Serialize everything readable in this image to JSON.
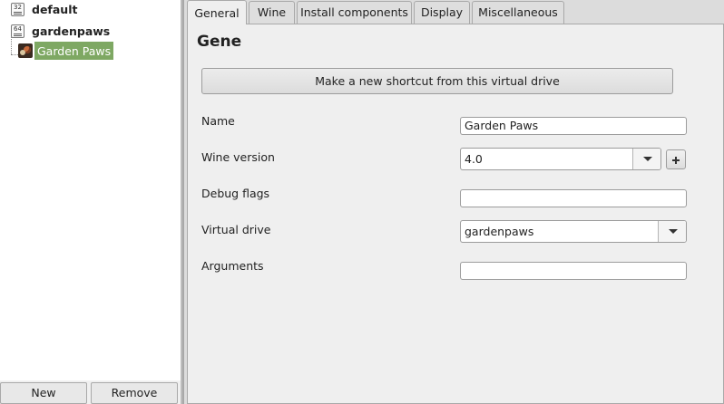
{
  "tree": {
    "prefixes": [
      {
        "arch": "32",
        "name": "default"
      },
      {
        "arch": "64",
        "name": "gardenpaws"
      }
    ],
    "shortcut": {
      "label": "Garden Paws",
      "icon": "garden-paws-app-icon"
    }
  },
  "left_buttons": {
    "new_label": "New",
    "remove_label": "Remove"
  },
  "tabs": [
    {
      "label": "General"
    },
    {
      "label": "Wine"
    },
    {
      "label": "Install components"
    },
    {
      "label": "Display"
    },
    {
      "label": "Miscellaneous"
    }
  ],
  "general": {
    "title": "Gene",
    "shortcut_button": "Make a new shortcut from this virtual drive",
    "fields": {
      "name": {
        "label": "Name",
        "value": "Garden Paws"
      },
      "wine_version": {
        "label": "Wine version",
        "value": "4.0"
      },
      "debug_flags": {
        "label": "Debug flags",
        "value": ""
      },
      "virtual_drive": {
        "label": "Virtual drive",
        "value": "gardenpaws"
      },
      "arguments": {
        "label": "Arguments",
        "value": ""
      }
    }
  },
  "colors": {
    "selection": "#7ea863",
    "panel": "#efefef"
  }
}
